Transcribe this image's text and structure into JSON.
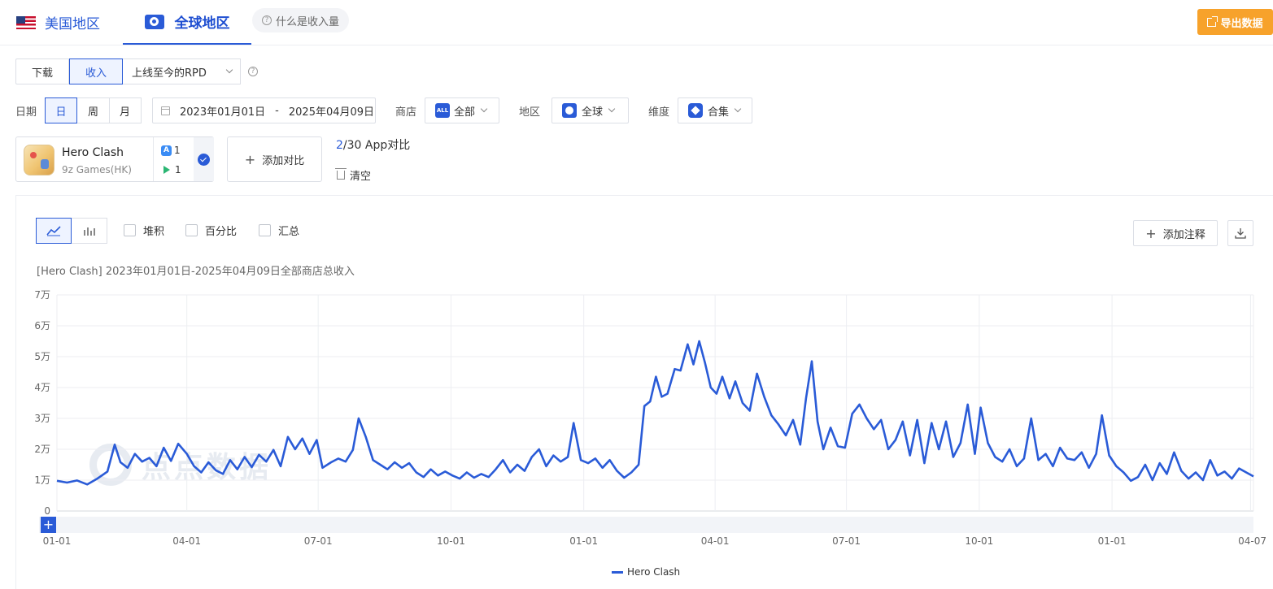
{
  "tabs": {
    "us": "美国地区",
    "global": "全球地区",
    "help": "什么是收入量"
  },
  "export_label": "导出数据",
  "metric": {
    "download": "下载",
    "revenue": "收入",
    "selected": "上线至今的RPD"
  },
  "filters": {
    "date_label": "日期",
    "day": "日",
    "week": "周",
    "month": "月",
    "date_start": "2023年01月01日",
    "date_sep": "-",
    "date_end": "2025年04月09日",
    "store_label": "商店",
    "store_value": "全部",
    "store_badge": "ALL",
    "region_label": "地区",
    "region_value": "全球",
    "dim_label": "维度",
    "dim_value": "合集"
  },
  "app": {
    "name": "Hero Clash",
    "publisher": "9z Games(HK)",
    "ios_count": "1",
    "android_count": "1"
  },
  "compare": {
    "add_label": "添加对比",
    "current": "2",
    "rest": "/30 App对比",
    "clear": "清空"
  },
  "options": {
    "stack": "堆积",
    "percent": "百分比",
    "total": "汇总"
  },
  "annot_label": "添加注释",
  "watermark": "点点数据",
  "chart_data": {
    "type": "line",
    "title": "[Hero Clash] 2023年01月01日-2025年04月09日全部商店总收入",
    "x_range": [
      "2023-01-01",
      "2025-04-09"
    ],
    "y_range": [
      0,
      70000
    ],
    "y_ticks": [
      {
        "v": 0,
        "label": "0"
      },
      {
        "v": 10000,
        "label": "1万"
      },
      {
        "v": 20000,
        "label": "2万"
      },
      {
        "v": 30000,
        "label": "3万"
      },
      {
        "v": 40000,
        "label": "4万"
      },
      {
        "v": 50000,
        "label": "5万"
      },
      {
        "v": 60000,
        "label": "6万"
      },
      {
        "v": 70000,
        "label": "7万"
      }
    ],
    "x_ticks": [
      {
        "d": "2023-01-01",
        "label": "01-01"
      },
      {
        "d": "2023-04-01",
        "label": "04-01"
      },
      {
        "d": "2023-07-01",
        "label": "07-01"
      },
      {
        "d": "2023-10-01",
        "label": "10-01"
      },
      {
        "d": "2024-01-01",
        "label": "01-01"
      },
      {
        "d": "2024-04-01",
        "label": "04-01"
      },
      {
        "d": "2024-07-01",
        "label": "07-01"
      },
      {
        "d": "2024-10-01",
        "label": "10-01"
      },
      {
        "d": "2025-01-01",
        "label": "01-01"
      },
      {
        "d": "2025-04-07",
        "label": "04-07"
      }
    ],
    "series": [
      {
        "name": "Hero Clash",
        "color": "#2a5bd7",
        "points": [
          [
            "2023-01-01",
            9800
          ],
          [
            "2023-01-08",
            9200
          ],
          [
            "2023-01-15",
            9900
          ],
          [
            "2023-01-22",
            8600
          ],
          [
            "2023-01-29",
            10500
          ],
          [
            "2023-02-05",
            12800
          ],
          [
            "2023-02-10",
            21500
          ],
          [
            "2023-02-14",
            15800
          ],
          [
            "2023-02-19",
            14000
          ],
          [
            "2023-02-24",
            18500
          ],
          [
            "2023-03-01",
            16000
          ],
          [
            "2023-03-06",
            17200
          ],
          [
            "2023-03-11",
            14500
          ],
          [
            "2023-03-16",
            20500
          ],
          [
            "2023-03-21",
            16200
          ],
          [
            "2023-03-26",
            21800
          ],
          [
            "2023-04-01",
            18500
          ],
          [
            "2023-04-06",
            14500
          ],
          [
            "2023-04-11",
            12500
          ],
          [
            "2023-04-16",
            15800
          ],
          [
            "2023-04-21",
            13200
          ],
          [
            "2023-04-26",
            12000
          ],
          [
            "2023-05-01",
            16500
          ],
          [
            "2023-05-06",
            13500
          ],
          [
            "2023-05-11",
            17500
          ],
          [
            "2023-05-16",
            14200
          ],
          [
            "2023-05-21",
            18200
          ],
          [
            "2023-05-26",
            16000
          ],
          [
            "2023-05-31",
            19800
          ],
          [
            "2023-06-05",
            14500
          ],
          [
            "2023-06-10",
            24000
          ],
          [
            "2023-06-15",
            20000
          ],
          [
            "2023-06-20",
            23500
          ],
          [
            "2023-06-25",
            18500
          ],
          [
            "2023-06-30",
            23000
          ],
          [
            "2023-07-04",
            14000
          ],
          [
            "2023-07-10",
            15800
          ],
          [
            "2023-07-15",
            17000
          ],
          [
            "2023-07-20",
            16000
          ],
          [
            "2023-07-25",
            19800
          ],
          [
            "2023-07-29",
            30000
          ],
          [
            "2023-08-03",
            24000
          ],
          [
            "2023-08-08",
            16500
          ],
          [
            "2023-08-13",
            15000
          ],
          [
            "2023-08-18",
            13500
          ],
          [
            "2023-08-23",
            15800
          ],
          [
            "2023-08-28",
            14000
          ],
          [
            "2023-09-02",
            15500
          ],
          [
            "2023-09-07",
            12500
          ],
          [
            "2023-09-12",
            11000
          ],
          [
            "2023-09-17",
            13500
          ],
          [
            "2023-09-22",
            11500
          ],
          [
            "2023-09-27",
            12800
          ],
          [
            "2023-10-02",
            11500
          ],
          [
            "2023-10-07",
            10500
          ],
          [
            "2023-10-12",
            12500
          ],
          [
            "2023-10-17",
            10800
          ],
          [
            "2023-10-22",
            12000
          ],
          [
            "2023-10-27",
            11000
          ],
          [
            "2023-11-01",
            13500
          ],
          [
            "2023-11-06",
            16500
          ],
          [
            "2023-11-11",
            12500
          ],
          [
            "2023-11-16",
            15000
          ],
          [
            "2023-11-21",
            13000
          ],
          [
            "2023-11-26",
            17500
          ],
          [
            "2023-12-01",
            20000
          ],
          [
            "2023-12-06",
            14500
          ],
          [
            "2023-12-11",
            18000
          ],
          [
            "2023-12-16",
            16000
          ],
          [
            "2023-12-21",
            17500
          ],
          [
            "2023-12-25",
            28500
          ],
          [
            "2023-12-30",
            16500
          ],
          [
            "2024-01-04",
            15500
          ],
          [
            "2024-01-09",
            17000
          ],
          [
            "2024-01-14",
            14000
          ],
          [
            "2024-01-19",
            16500
          ],
          [
            "2024-01-24",
            13000
          ],
          [
            "2024-01-29",
            10800
          ],
          [
            "2024-02-03",
            12500
          ],
          [
            "2024-02-08",
            15000
          ],
          [
            "2024-02-12",
            34000
          ],
          [
            "2024-02-16",
            35500
          ],
          [
            "2024-02-20",
            43500
          ],
          [
            "2024-02-24",
            37000
          ],
          [
            "2024-02-28",
            38000
          ],
          [
            "2024-03-04",
            46000
          ],
          [
            "2024-03-08",
            45500
          ],
          [
            "2024-03-13",
            54000
          ],
          [
            "2024-03-17",
            47500
          ],
          [
            "2024-03-21",
            55000
          ],
          [
            "2024-03-25",
            48000
          ],
          [
            "2024-03-29",
            40000
          ],
          [
            "2024-04-02",
            38000
          ],
          [
            "2024-04-06",
            43500
          ],
          [
            "2024-04-11",
            36500
          ],
          [
            "2024-04-15",
            42000
          ],
          [
            "2024-04-20",
            35000
          ],
          [
            "2024-04-25",
            32500
          ],
          [
            "2024-04-30",
            44500
          ],
          [
            "2024-05-05",
            37000
          ],
          [
            "2024-05-10",
            31000
          ],
          [
            "2024-05-15",
            28000
          ],
          [
            "2024-05-20",
            24500
          ],
          [
            "2024-05-25",
            29500
          ],
          [
            "2024-05-30",
            21500
          ],
          [
            "2024-06-03",
            36500
          ],
          [
            "2024-06-07",
            48500
          ],
          [
            "2024-06-11",
            29000
          ],
          [
            "2024-06-15",
            20000
          ],
          [
            "2024-06-20",
            27000
          ],
          [
            "2024-06-25",
            21000
          ],
          [
            "2024-06-30",
            20500
          ],
          [
            "2024-07-05",
            31500
          ],
          [
            "2024-07-10",
            34500
          ],
          [
            "2024-07-15",
            30000
          ],
          [
            "2024-07-20",
            26500
          ],
          [
            "2024-07-25",
            29500
          ],
          [
            "2024-07-30",
            20000
          ],
          [
            "2024-08-04",
            23000
          ],
          [
            "2024-08-09",
            29000
          ],
          [
            "2024-08-14",
            18000
          ],
          [
            "2024-08-19",
            29500
          ],
          [
            "2024-08-24",
            15500
          ],
          [
            "2024-08-29",
            28500
          ],
          [
            "2024-09-03",
            20000
          ],
          [
            "2024-09-08",
            29000
          ],
          [
            "2024-09-13",
            17500
          ],
          [
            "2024-09-18",
            22000
          ],
          [
            "2024-09-23",
            34500
          ],
          [
            "2024-09-28",
            18500
          ],
          [
            "2024-10-02",
            33500
          ],
          [
            "2024-10-07",
            22000
          ],
          [
            "2024-10-12",
            17500
          ],
          [
            "2024-10-17",
            16000
          ],
          [
            "2024-10-22",
            20000
          ],
          [
            "2024-10-27",
            14500
          ],
          [
            "2024-11-01",
            17000
          ],
          [
            "2024-11-06",
            30000
          ],
          [
            "2024-11-11",
            16500
          ],
          [
            "2024-11-16",
            18500
          ],
          [
            "2024-11-21",
            14500
          ],
          [
            "2024-11-26",
            20500
          ],
          [
            "2024-12-01",
            17000
          ],
          [
            "2024-12-06",
            16500
          ],
          [
            "2024-12-11",
            19000
          ],
          [
            "2024-12-16",
            14000
          ],
          [
            "2024-12-21",
            18500
          ],
          [
            "2024-12-25",
            31000
          ],
          [
            "2024-12-30",
            18000
          ],
          [
            "2025-01-04",
            14500
          ],
          [
            "2025-01-09",
            12500
          ],
          [
            "2025-01-14",
            9800
          ],
          [
            "2025-01-19",
            11000
          ],
          [
            "2025-01-24",
            15000
          ],
          [
            "2025-01-29",
            10000
          ],
          [
            "2025-02-03",
            15500
          ],
          [
            "2025-02-08",
            12000
          ],
          [
            "2025-02-13",
            19000
          ],
          [
            "2025-02-18",
            13000
          ],
          [
            "2025-02-23",
            10500
          ],
          [
            "2025-02-28",
            12500
          ],
          [
            "2025-03-05",
            10000
          ],
          [
            "2025-03-10",
            16500
          ],
          [
            "2025-03-15",
            11500
          ],
          [
            "2025-03-20",
            12800
          ],
          [
            "2025-03-25",
            10500
          ],
          [
            "2025-03-30",
            13800
          ],
          [
            "2025-04-04",
            12500
          ],
          [
            "2025-04-09",
            11200
          ]
        ]
      }
    ]
  }
}
